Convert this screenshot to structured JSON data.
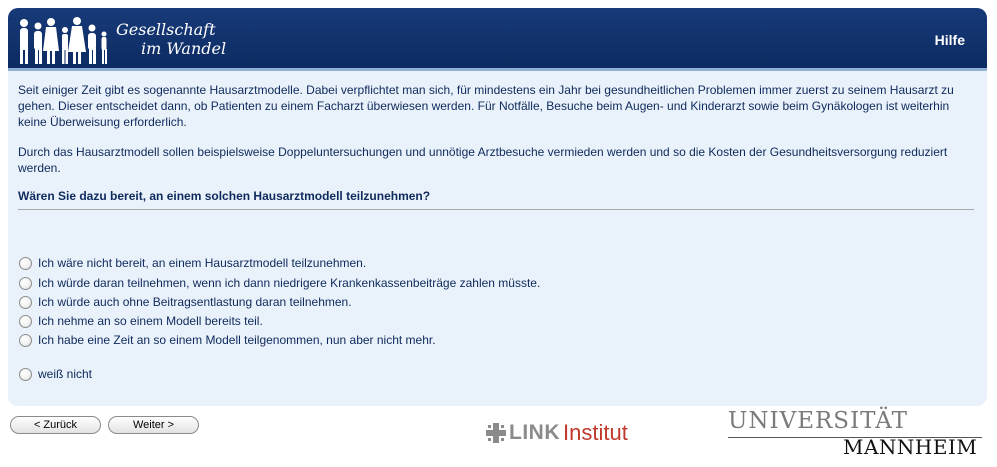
{
  "header": {
    "logo_line1": "Gesellschaft",
    "logo_line2": "im Wandel",
    "help_label": "Hilfe"
  },
  "intro": {
    "paragraph1": "Seit einiger Zeit gibt es sogenannte Hausarztmodelle. Dabei verpflichtet man sich, für mindestens ein Jahr bei gesundheitlichen Problemen immer zuerst zu seinem Hausarzt zu gehen. Dieser entscheidet dann, ob Patienten zu einem Facharzt überwiesen werden. Für Notfälle, Besuche beim Augen- und Kinderarzt sowie beim Gynäkologen ist weiterhin keine Überweisung erforderlich.",
    "paragraph2": "Durch das Hausarztmodell sollen beispielsweise Doppeluntersuchungen und unnötige Arztbesuche vermieden werden und so die Kosten der Gesundheitsversorgung reduziert werden."
  },
  "question": "Wären Sie dazu bereit, an einem solchen Hausarztmodell teilzunehmen?",
  "options": [
    "Ich wäre nicht bereit, an einem Hausarztmodell teilzunehmen.",
    "Ich würde daran teilnehmen, wenn ich dann niedrigere Krankenkassenbeiträge zahlen müsste.",
    "Ich würde auch ohne Beitragsentlastung daran teilnehmen.",
    "Ich nehme an so einem Modell bereits teil.",
    "Ich habe eine Zeit an so einem Modell teilgenommen, nun aber nicht mehr.",
    "weiß nicht"
  ],
  "nav": {
    "back_label": "< Zurück",
    "next_label": "Weiter >"
  },
  "footer": {
    "link_word": "LINK",
    "link_institut": "Institut",
    "uni_line1": "UNIVERSITÄT",
    "uni_line2": "MANNHEIM"
  },
  "colors": {
    "header_bg": "#0d2b63",
    "panel_bg": "#e9f1fa",
    "text": "#0e2a5c",
    "link_red": "#c0392b"
  }
}
